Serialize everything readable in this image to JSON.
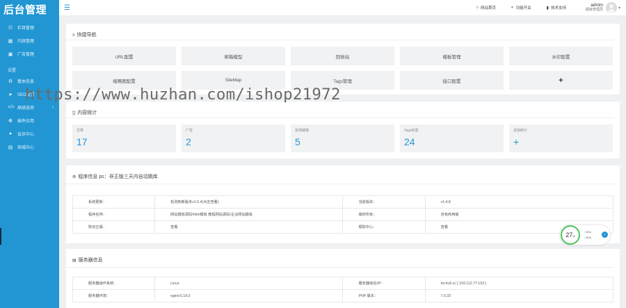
{
  "app": {
    "logo_text": "后台管理"
  },
  "sidebar": {
    "items": [
      {
        "label": "栏目管理",
        "icon": "sitemap-icon"
      },
      {
        "label": "内容管理",
        "icon": "list-icon"
      },
      {
        "label": "广告管理",
        "icon": "image-icon"
      }
    ],
    "section_label": "设置",
    "settings_items": [
      {
        "label": "基本信息",
        "icon": "gear-icon"
      },
      {
        "label": "SEO设置",
        "icon": "send-icon"
      },
      {
        "label": "高级选项",
        "icon": "code-icon",
        "has_submenu": true
      },
      {
        "label": "插件应用",
        "icon": "cog-icon"
      },
      {
        "label": "会员中心",
        "icon": "user-icon"
      },
      {
        "label": "商城中心",
        "icon": "cart-icon"
      }
    ]
  },
  "header": {
    "links": [
      {
        "label": "网站首页",
        "icon": "home-icon"
      },
      {
        "label": "功能开关",
        "icon": "toggle-icon"
      },
      {
        "label": "技术支持",
        "icon": "bookmark-icon"
      }
    ],
    "user": {
      "name": "admin",
      "role": "超级管理员"
    }
  },
  "quick_nav": {
    "title": "快捷导航",
    "items": [
      "URL配置",
      "邮箱模型",
      "回收站",
      "模板管理",
      "水印配置",
      "缩略图配置",
      "SiteMap",
      "Tags管理",
      "接口配置",
      "+"
    ]
  },
  "stats": {
    "title": "内容统计",
    "items": [
      {
        "label": "文章",
        "value": "17"
      },
      {
        "label": "广告",
        "value": "2"
      },
      {
        "label": "友情链接",
        "value": "5"
      },
      {
        "label": "Tags标签",
        "value": "24"
      },
      {
        "label": "添加统计",
        "value": "+"
      }
    ]
  },
  "program_info": {
    "title": "程序信息 ps：非正版三天内自动跳库",
    "rows": [
      {
        "label1": "系统更新：",
        "value1": "检测到新版本v1.5.4(点击查看)",
        "label2": "当前版本：",
        "value2": "v1.4.8"
      },
      {
        "label1": "程序名称：",
        "value1": "网站模板源码/html模板 教程网站源码/企业网站模板",
        "label2": "版权所有：",
        "value2": "自有商用版"
      },
      {
        "label1": "购买正版：",
        "value1": "查看",
        "label2": "帮助中心：",
        "value2": "查看"
      }
    ]
  },
  "server_info": {
    "title": "服务器信息",
    "rows": [
      {
        "label1": "服务器操作系统：",
        "value1": "Linux",
        "label2": "服务器域名/IP：",
        "value2": "txt.hu6.cc [ 193.112.77.133 ]"
      },
      {
        "label1": "服务器环境：",
        "value1": "nginx/1.18.0",
        "label2": "PHP 版本：",
        "value2": "7.0.33"
      }
    ]
  },
  "speed_widget": {
    "percent": "27",
    "unit": "%",
    "up": "0K/s",
    "down": "0K/s"
  },
  "watermark": "https://www.huzhan.com/ishop21972"
}
